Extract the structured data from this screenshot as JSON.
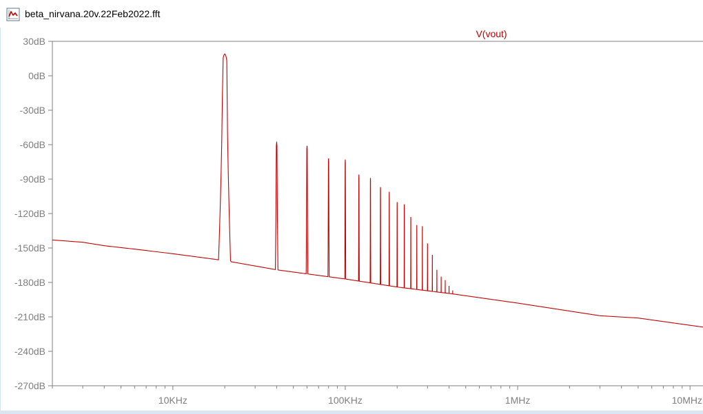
{
  "window": {
    "title": "beta_nirvana.20v.22Feb2022.fft",
    "icon": "waveform-plot-icon"
  },
  "colors": {
    "trace": "#c00000",
    "axis": "#7f7f7f",
    "axis_label": "#7f7f7f",
    "tick": "#7f7f7f",
    "background": "#ffffff"
  },
  "chart_data": {
    "type": "line",
    "title": "",
    "xlabel": "",
    "ylabel": "",
    "xscale": "log",
    "xlim": [
      2000,
      12000000
    ],
    "ylim": [
      -270,
      30
    ],
    "grid": false,
    "legend": {
      "entries": [
        "V(vout)"
      ],
      "placement": "top-center"
    },
    "x_tick_labels": [
      "10KHz",
      "100KHz",
      "1MHz",
      "10MHz"
    ],
    "x_tick_values": [
      10000,
      100000,
      1000000,
      10000000
    ],
    "y_tick_labels": [
      "30dB",
      "0dB",
      "-30dB",
      "-60dB",
      "-90dB",
      "-120dB",
      "-150dB",
      "-180dB",
      "-210dB",
      "-240dB",
      "-270dB"
    ],
    "y_tick_values": [
      30,
      0,
      -30,
      -60,
      -90,
      -120,
      -150,
      -180,
      -210,
      -240,
      -270
    ],
    "series": [
      {
        "name": "V(vout)",
        "noise_floor": {
          "x": [
            2000,
            3000,
            4000,
            6000,
            10000,
            20000,
            40000,
            100000,
            200000,
            420000,
            1000000,
            3000000,
            5000000,
            12000000
          ],
          "y": [
            -143,
            -145,
            -148,
            -151,
            -155,
            -161,
            -169,
            -177,
            -184,
            -190,
            -198,
            -209,
            -211,
            -219
          ]
        },
        "harmonics": {
          "freq_khz": [
            20,
            40,
            60,
            80,
            100,
            120,
            140,
            160,
            180,
            200,
            220,
            240,
            260,
            280,
            300,
            320,
            340,
            360,
            380,
            400,
            420
          ],
          "peak_db": [
            19,
            -58,
            -61,
            -72,
            -73,
            -86,
            -89,
            -97,
            -101,
            -110,
            -112,
            -123,
            -130,
            -131,
            -146,
            -156,
            -169,
            -175,
            -178,
            -183,
            -187
          ]
        }
      }
    ]
  }
}
